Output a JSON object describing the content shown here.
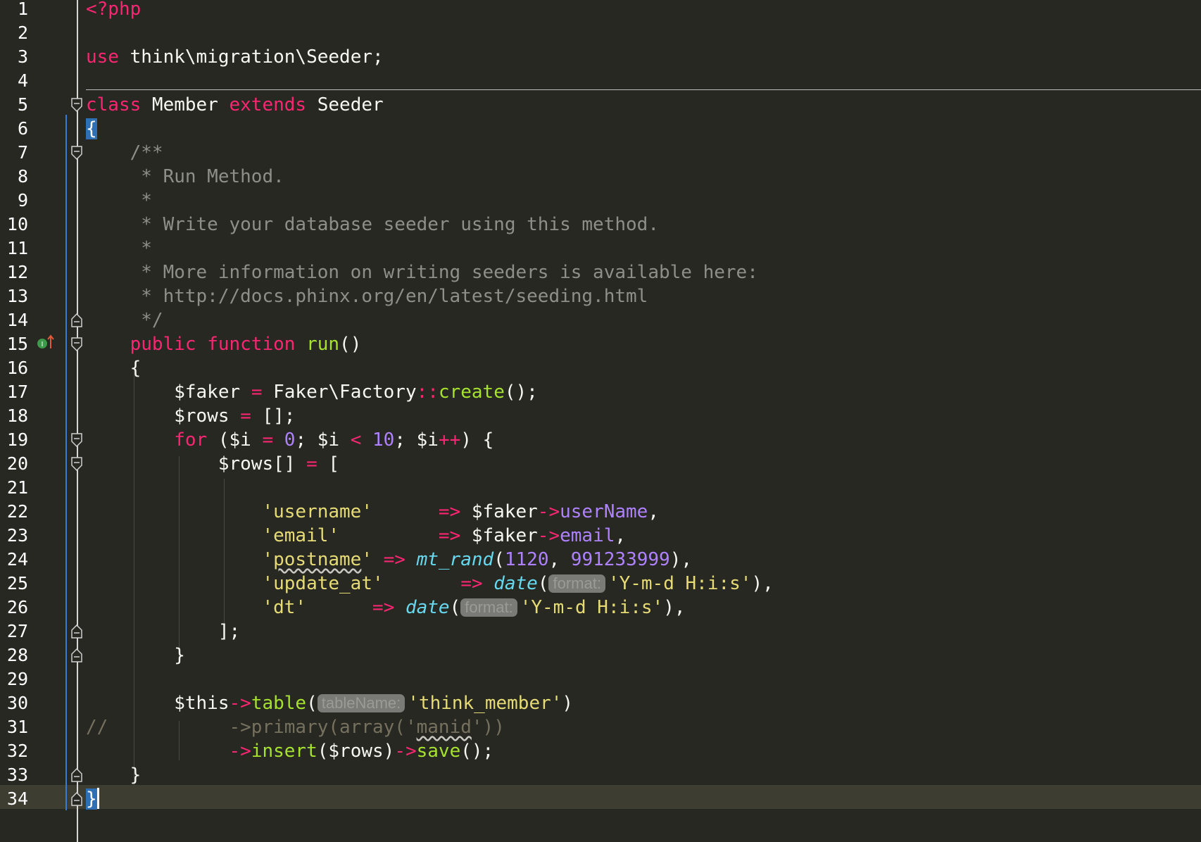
{
  "editor": {
    "current_line_number": "34"
  },
  "lines": [
    {
      "n": "1",
      "code": [
        {
          "t": "<?php",
          "c": "kw"
        }
      ]
    },
    {
      "n": "2",
      "code": []
    },
    {
      "n": "3",
      "code": [
        {
          "t": "use ",
          "c": "kw"
        },
        {
          "t": "think\\migration\\Seeder;",
          "c": "plain"
        }
      ]
    },
    {
      "n": "4",
      "code": []
    },
    {
      "n": "5",
      "code": [
        {
          "t": "class ",
          "c": "kw"
        },
        {
          "t": "Member ",
          "c": "plain"
        },
        {
          "t": "extends ",
          "c": "kw"
        },
        {
          "t": "Seeder",
          "c": "plain"
        }
      ]
    },
    {
      "n": "6",
      "code": [
        {
          "t": "{",
          "c": "brace-hl"
        }
      ]
    },
    {
      "n": "7",
      "code": [
        {
          "t": "    /**",
          "c": "cmt"
        }
      ]
    },
    {
      "n": "8",
      "code": [
        {
          "t": "     * Run Method.",
          "c": "cmt"
        }
      ]
    },
    {
      "n": "9",
      "code": [
        {
          "t": "     *",
          "c": "cmt"
        }
      ]
    },
    {
      "n": "10",
      "code": [
        {
          "t": "     * Write your database seeder using this method.",
          "c": "cmt"
        }
      ]
    },
    {
      "n": "11",
      "code": [
        {
          "t": "     *",
          "c": "cmt"
        }
      ]
    },
    {
      "n": "12",
      "code": [
        {
          "t": "     * More information on writing seeders is available here:",
          "c": "cmt"
        }
      ]
    },
    {
      "n": "13",
      "code": [
        {
          "t": "     * http://docs.phinx.org/en/latest/seeding.html",
          "c": "cmt"
        }
      ]
    },
    {
      "n": "14",
      "code": [
        {
          "t": "     */",
          "c": "cmt"
        }
      ]
    },
    {
      "n": "15",
      "code": [
        {
          "t": "    public ",
          "c": "kw"
        },
        {
          "t": "function ",
          "c": "kw"
        },
        {
          "t": "run",
          "c": "fn"
        },
        {
          "t": "()",
          "c": "plain"
        }
      ]
    },
    {
      "n": "16",
      "code": [
        {
          "t": "    {",
          "c": "plain"
        }
      ]
    },
    {
      "n": "17",
      "code": [
        {
          "t": "        $faker ",
          "c": "plain"
        },
        {
          "t": "= ",
          "c": "op"
        },
        {
          "t": "Faker\\Factory",
          "c": "plain"
        },
        {
          "t": "::",
          "c": "op"
        },
        {
          "t": "create",
          "c": "fn"
        },
        {
          "t": "();",
          "c": "plain"
        }
      ]
    },
    {
      "n": "18",
      "code": [
        {
          "t": "        $rows ",
          "c": "plain"
        },
        {
          "t": "= ",
          "c": "op"
        },
        {
          "t": "[];",
          "c": "plain"
        }
      ]
    },
    {
      "n": "19",
      "code": [
        {
          "t": "        for ",
          "c": "kw"
        },
        {
          "t": "($i ",
          "c": "plain"
        },
        {
          "t": "= ",
          "c": "op"
        },
        {
          "t": "0",
          "c": "num"
        },
        {
          "t": "; $i ",
          "c": "plain"
        },
        {
          "t": "< ",
          "c": "op"
        },
        {
          "t": "10",
          "c": "num"
        },
        {
          "t": "; $i",
          "c": "plain"
        },
        {
          "t": "++",
          "c": "op"
        },
        {
          "t": ") {",
          "c": "plain"
        }
      ]
    },
    {
      "n": "20",
      "code": [
        {
          "t": "            $rows[] ",
          "c": "plain"
        },
        {
          "t": "= ",
          "c": "op"
        },
        {
          "t": "[",
          "c": "plain"
        }
      ]
    },
    {
      "n": "21",
      "code": []
    },
    {
      "n": "22",
      "code": [
        {
          "t": "                'username'      ",
          "c": "str"
        },
        {
          "t": "=> ",
          "c": "op"
        },
        {
          "t": "$faker",
          "c": "plain"
        },
        {
          "t": "->",
          "c": "op"
        },
        {
          "t": "userName",
          "c": "prop"
        },
        {
          "t": ",",
          "c": "plain"
        }
      ]
    },
    {
      "n": "23",
      "code": [
        {
          "t": "                'email'         ",
          "c": "str"
        },
        {
          "t": "=> ",
          "c": "op"
        },
        {
          "t": "$faker",
          "c": "plain"
        },
        {
          "t": "->",
          "c": "op"
        },
        {
          "t": "email",
          "c": "prop"
        },
        {
          "t": ",",
          "c": "plain"
        }
      ]
    },
    {
      "n": "24",
      "code": [
        {
          "t": "                '",
          "c": "str"
        },
        {
          "t": "postname",
          "c": "str squig"
        },
        {
          "t": "' ",
          "c": "str"
        },
        {
          "t": "=> ",
          "c": "op"
        },
        {
          "t": "mt_rand",
          "c": "ital"
        },
        {
          "t": "(",
          "c": "plain"
        },
        {
          "t": "1120",
          "c": "num"
        },
        {
          "t": ", ",
          "c": "plain"
        },
        {
          "t": "991233999",
          "c": "num"
        },
        {
          "t": "),",
          "c": "plain"
        }
      ]
    },
    {
      "n": "25",
      "code": [
        {
          "t": "                'update_at'       ",
          "c": "str"
        },
        {
          "t": "=> ",
          "c": "op"
        },
        {
          "t": "date",
          "c": "ital"
        },
        {
          "t": "(",
          "c": "plain"
        },
        {
          "t": "format:",
          "c": "hint"
        },
        {
          "t": "'Y-m-d H:i:s'",
          "c": "str"
        },
        {
          "t": "),",
          "c": "plain"
        }
      ]
    },
    {
      "n": "26",
      "code": [
        {
          "t": "                'dt'      ",
          "c": "str"
        },
        {
          "t": "=> ",
          "c": "op"
        },
        {
          "t": "date",
          "c": "ital"
        },
        {
          "t": "(",
          "c": "plain"
        },
        {
          "t": "format:",
          "c": "hint"
        },
        {
          "t": "'Y-m-d H:i:s'",
          "c": "str"
        },
        {
          "t": "),",
          "c": "plain"
        }
      ]
    },
    {
      "n": "27",
      "code": [
        {
          "t": "            ];",
          "c": "plain"
        }
      ]
    },
    {
      "n": "28",
      "code": [
        {
          "t": "        }",
          "c": "plain"
        }
      ]
    },
    {
      "n": "29",
      "code": []
    },
    {
      "n": "30",
      "code": [
        {
          "t": "        $this",
          "c": "plain"
        },
        {
          "t": "->",
          "c": "op"
        },
        {
          "t": "table",
          "c": "fn"
        },
        {
          "t": "(",
          "c": "plain"
        },
        {
          "t": "tableName:",
          "c": "hint"
        },
        {
          "t": "'think_member'",
          "c": "str"
        },
        {
          "t": ")",
          "c": "plain"
        }
      ]
    },
    {
      "n": "31",
      "code": [
        {
          "t": "//           ->primary(array('",
          "c": "dimcmt"
        },
        {
          "t": "manid",
          "c": "dimcmt squig"
        },
        {
          "t": "'))",
          "c": "dimcmt"
        }
      ]
    },
    {
      "n": "32",
      "code": [
        {
          "t": "             ",
          "c": "plain"
        },
        {
          "t": "->",
          "c": "op"
        },
        {
          "t": "insert",
          "c": "fn"
        },
        {
          "t": "($rows)",
          "c": "plain"
        },
        {
          "t": "->",
          "c": "op"
        },
        {
          "t": "save",
          "c": "fn"
        },
        {
          "t": "();",
          "c": "plain"
        }
      ]
    },
    {
      "n": "33",
      "code": [
        {
          "t": "    }",
          "c": "plain"
        }
      ]
    },
    {
      "n": "34",
      "code": [
        {
          "t": "}",
          "c": "brace-hl"
        },
        {
          "t": "",
          "c": "caret"
        }
      ]
    }
  ],
  "folds": {
    "open": [
      "5",
      "7",
      "15",
      "19",
      "20"
    ],
    "close": [
      "14",
      "27",
      "28",
      "33",
      "34"
    ]
  },
  "icons": {
    "override_marker": "override-method-icon"
  }
}
